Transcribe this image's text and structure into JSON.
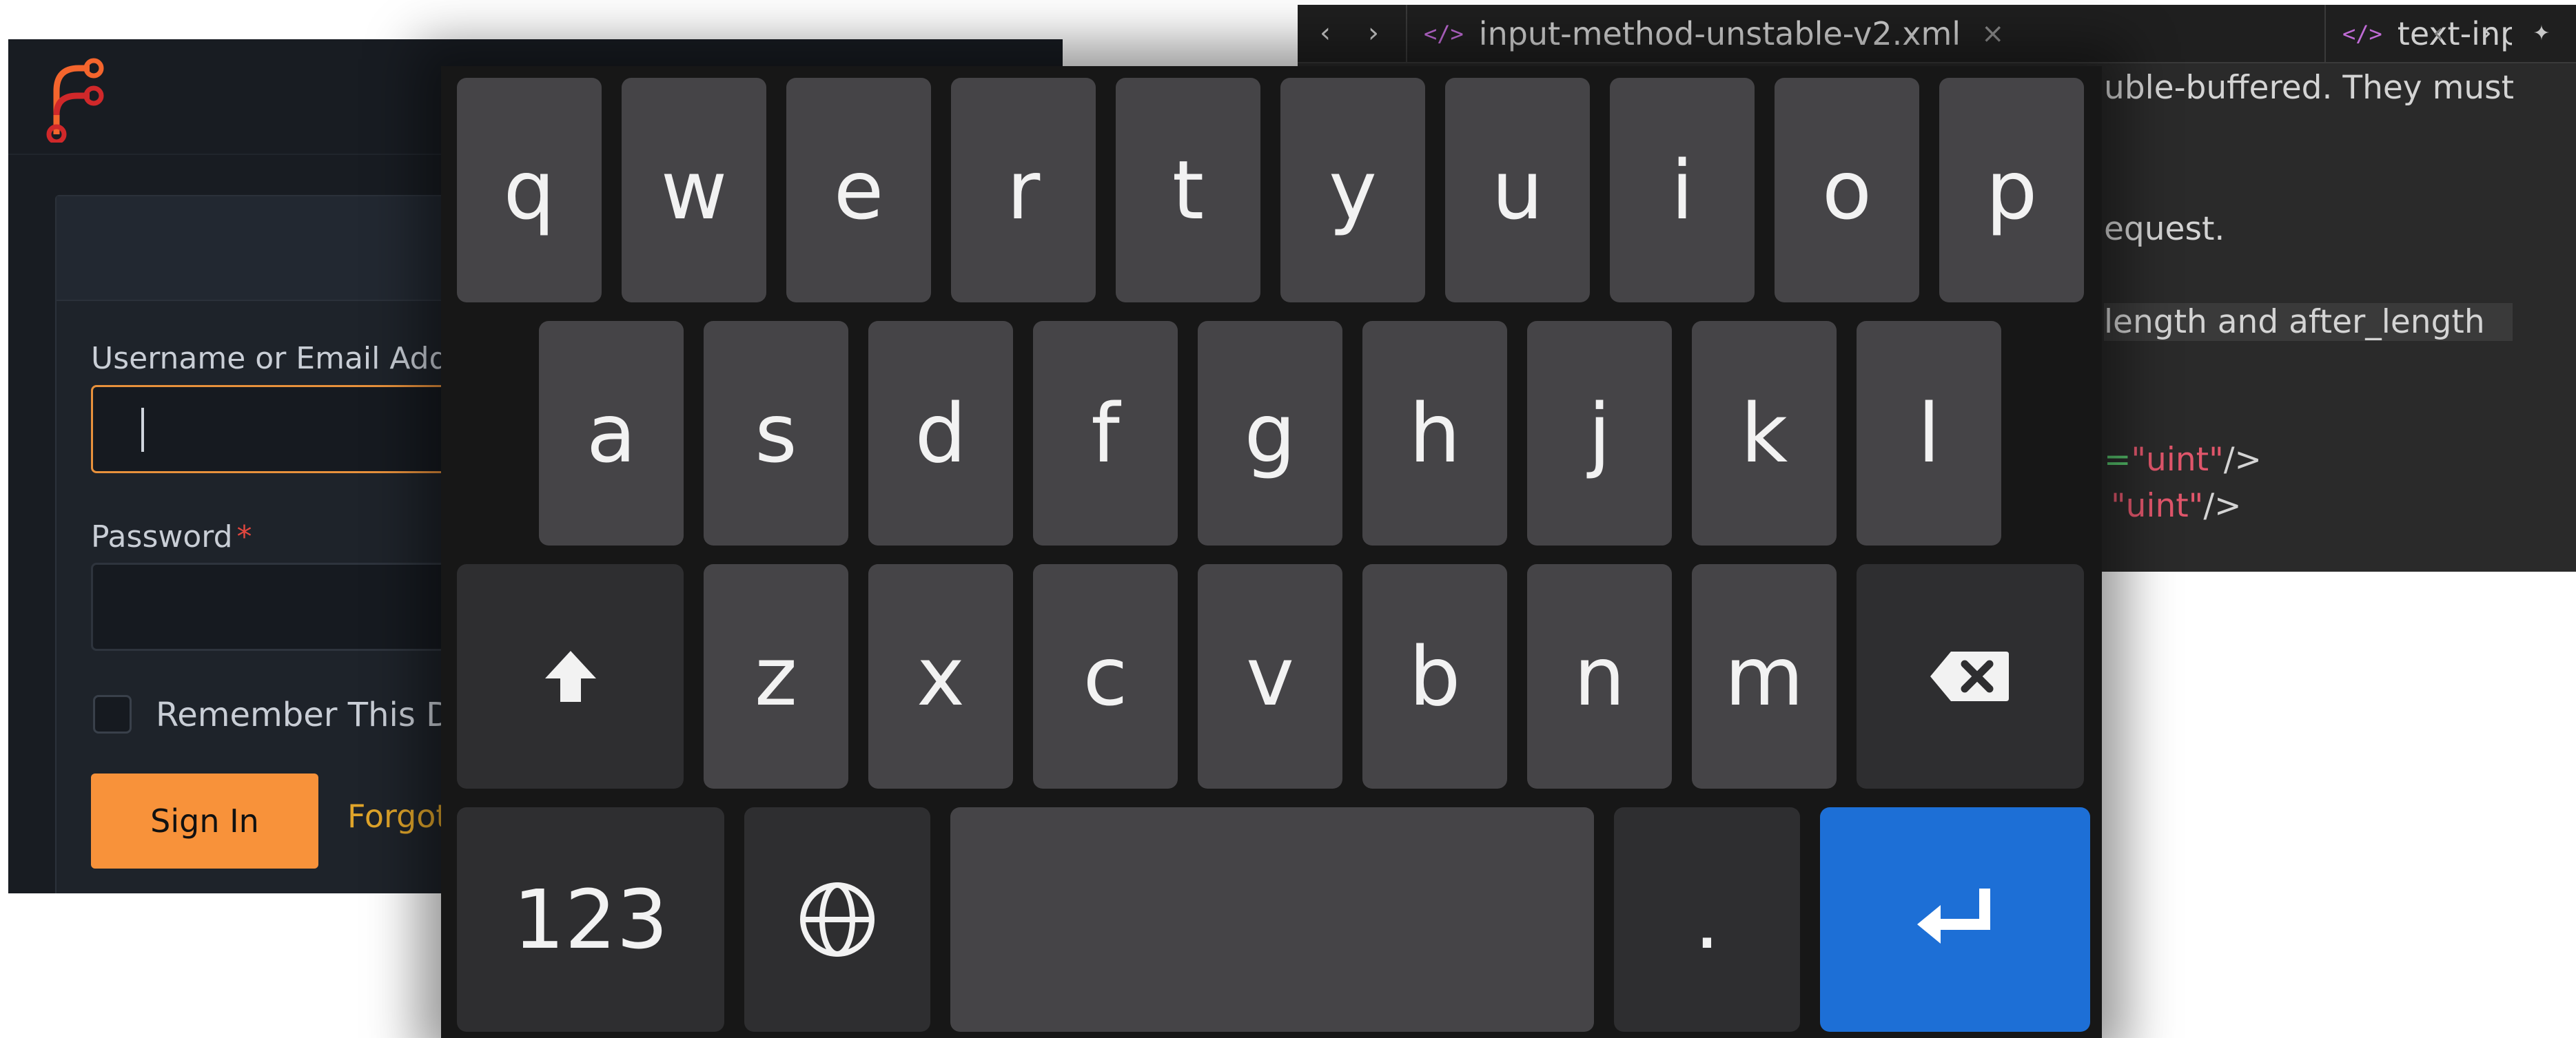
{
  "editor": {
    "nav_back": "‹",
    "nav_forward": "›",
    "tabs": [
      {
        "title": "input-method-unstable-v2.xml",
        "icon": "xml-code-icon",
        "close": "×"
      },
      {
        "title": "text-input-unstab",
        "icon": "xml-code-icon"
      }
    ],
    "tab_nav_back": "‹",
    "tab_nav_forward": "›",
    "pin_glyph": "✦",
    "code": {
      "line1": "uble-buffered. They must",
      "line2": "equest.",
      "line3": "length and after_length",
      "line4_eq": "=",
      "line4_str": "\"uint\"",
      "line4_end": "/>",
      "line5_str": "\"uint\"",
      "line5_end": "/>"
    }
  },
  "login": {
    "username_label": "Username or Email Address",
    "username_value": "",
    "password_label": "Password",
    "password_required": "*",
    "password_value": "",
    "remember_label": "Remember This Device",
    "remember_checked": false,
    "signin_label": "Sign In",
    "forgot_label": "Forgot Password?",
    "accent_color": "#f8923a",
    "logo_icon": "forgejo-logo-icon"
  },
  "keyboard": {
    "row1": [
      "q",
      "w",
      "e",
      "r",
      "t",
      "y",
      "u",
      "i",
      "o",
      "p"
    ],
    "row2": [
      "a",
      "s",
      "d",
      "f",
      "g",
      "h",
      "j",
      "k",
      "l"
    ],
    "row3": [
      "z",
      "x",
      "c",
      "v",
      "b",
      "n",
      "m"
    ],
    "shift_icon": "shift-arrow-icon",
    "backspace_icon": "backspace-icon",
    "numbers_label": "123",
    "globe_icon": "globe-icon",
    "space_label": "",
    "period_label": ".",
    "enter_icon": "enter-return-icon",
    "enter_color": "#1d6fd6"
  }
}
